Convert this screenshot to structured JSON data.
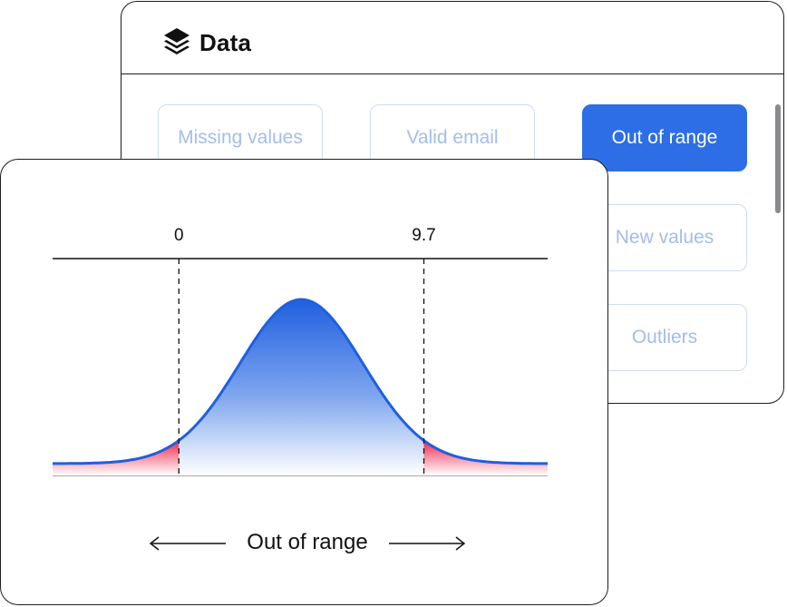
{
  "panel": {
    "title": "Data",
    "title_icon": "layers-icon",
    "chips": [
      {
        "label": "Missing values",
        "active": false
      },
      {
        "label": "Valid email",
        "active": false
      },
      {
        "label": "Out of range",
        "active": true
      },
      {
        "label": "New values",
        "active": false
      },
      {
        "label": "Outliers",
        "active": false
      }
    ]
  },
  "card": {
    "range_label": "Out of range",
    "arrows": [
      "arrow-left-icon",
      "arrow-right-icon"
    ]
  },
  "chart_data": {
    "type": "area",
    "distribution": "normal",
    "tick_labels": [
      "0",
      "9.7"
    ],
    "thresholds": [
      0,
      9.7
    ],
    "xlim": [
      -5.0,
      14.6
    ],
    "mean": 4.85,
    "std": 2.45,
    "title": "",
    "xlabel": "",
    "ylabel": "",
    "annotation": "Out of range",
    "colors": {
      "in_range": "#1f5fe0",
      "out_of_range": "#f0294f",
      "curve": "#1f5fe0"
    }
  },
  "colors": {
    "accent": "#2d6ee6",
    "chip_text": "#a4bdec",
    "chip_border": "#cfdcf5",
    "border": "#1d1d1f"
  }
}
